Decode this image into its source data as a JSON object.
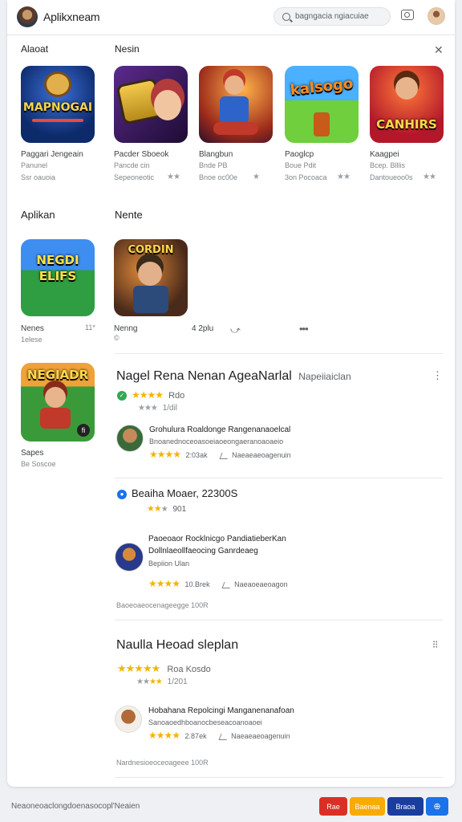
{
  "header": {
    "app_title": "Aplikxneam",
    "search_placeholder": "bagngacia ngiacuiae"
  },
  "section1": {
    "left_label": "Alaoat",
    "right_label": "Nesin",
    "apps": [
      {
        "art": "MAPNOGAI",
        "name": "Paggari Jengeain",
        "dev": "Panunel",
        "meta": "Ssr oauoia",
        "rating": ""
      },
      {
        "art": "",
        "name": "Pacder Sboeok",
        "dev": "Pancde cin",
        "meta": "Sepeoneotic",
        "rating": "★★"
      },
      {
        "art": "",
        "name": "Blangbun",
        "dev": "Bnde PB",
        "meta": "Bnoe oc00e",
        "rating": "★"
      },
      {
        "art": "kalsogo",
        "name": "Paoglcp",
        "dev": "Boue Pdit",
        "meta": "3on Pocoaca",
        "rating": "★★"
      },
      {
        "art": "CANHIRS",
        "name": "Kaagpei",
        "dev": "Bcep. Blllis",
        "meta": "Dantoueoo0s",
        "rating": "★★"
      }
    ]
  },
  "section2": {
    "left_label": "Aplikan",
    "right_label": "Nente",
    "apps": [
      {
        "art": "NEGDI ELIFS",
        "name": "Nenes",
        "dev": "1elese",
        "extra": "11*"
      },
      {
        "art": "CORDIN",
        "name": "Nenng",
        "dev": "©",
        "extra": "4 2plu"
      }
    ],
    "featured": {
      "art": "NEGIADR",
      "name": "Sapes",
      "dev": "Be Soscoe"
    }
  },
  "reviews": [
    {
      "title": "Nagel Rena Nenan AgeaNarlal",
      "title_suffix": "Napeiiaiclan",
      "rating_label": "Rdo",
      "rating_count": "1/dil",
      "items": [
        {
          "text": "Grohulura Roaldonge Rangenanaoelcal",
          "text2": "Bnoanednoceoasoeiaoeongaeranoaoaeio",
          "rating": "2:03ak",
          "meta": "Naeaeaeoagenuin"
        }
      ]
    },
    {
      "title": "Beaiha Moaer, 22300S",
      "rating_label": "901",
      "items": [
        {
          "text": "Paoeoaor Rocklnicgo PandiatieberKan",
          "text2": "Dollnlaeollfaeocing Ganrdeaeg",
          "text3": "Bepiion Ulan",
          "rating": "10.Brek",
          "meta": "Naeaoeaeoagon"
        }
      ],
      "footer": "Baoeoaeocenageegge 100R"
    },
    {
      "title": "Naulla Heoad sleplan",
      "rating_label": "Roa Kosdo",
      "rating_count": "1/201",
      "items": [
        {
          "text": "Hobahana Repolcingi Manganenanafoan",
          "text2": "Sanoaoedhboanocbeseacoanoaoei",
          "rating": "2.87ek",
          "meta": "Naeaeaeoagenuin"
        }
      ],
      "footer": "Nardnesioeoceoageee 100R"
    }
  ],
  "footer": {
    "text": "Neaoneoaclongdoenasocopl'Neaien",
    "buttons": [
      "Rae",
      "Baenaa",
      "Braoa",
      "⊕"
    ]
  }
}
